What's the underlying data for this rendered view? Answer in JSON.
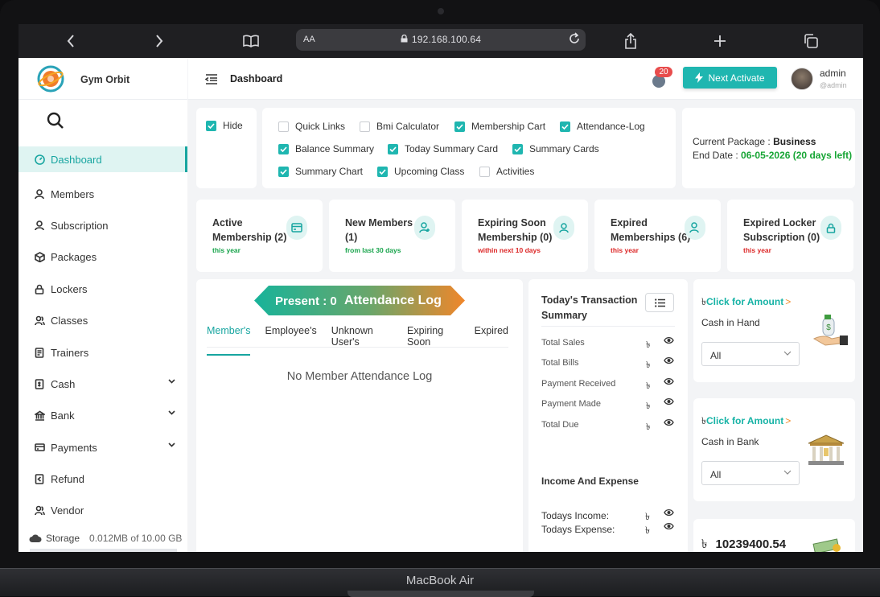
{
  "browser": {
    "address_prefix": "AA",
    "url": "192.168.100.64"
  },
  "device": {
    "label": "MacBook Air"
  },
  "app": {
    "name": "Gym Orbit"
  },
  "topbar": {
    "page_title": "Dashboard",
    "notification_count": "20",
    "next_activate_label": "Next Activate",
    "user_name": "admin",
    "user_handle": "@admin"
  },
  "sidebar": {
    "items": [
      {
        "label": "Dashboard",
        "icon": "dashboard-icon",
        "active": true
      },
      {
        "label": "Members",
        "icon": "user-icon"
      },
      {
        "label": "Subscription",
        "icon": "user-icon"
      },
      {
        "label": "Packages",
        "icon": "box-icon"
      },
      {
        "label": "Lockers",
        "icon": "lock-icon"
      },
      {
        "label": "Classes",
        "icon": "users-icon"
      },
      {
        "label": "Trainers",
        "icon": "document-icon"
      },
      {
        "label": "Cash",
        "icon": "cash-icon",
        "dropdown": true
      },
      {
        "label": "Bank",
        "icon": "bank-icon",
        "dropdown": true
      },
      {
        "label": "Payments",
        "icon": "payment-icon",
        "dropdown": true
      },
      {
        "label": "Refund",
        "icon": "refund-icon"
      },
      {
        "label": "Vendor",
        "icon": "users-icon"
      }
    ],
    "storage_label": "Storage",
    "storage_value": "0.012MB of 10.00 GB"
  },
  "settings": {
    "hide_label": "Hide",
    "options": [
      {
        "label": "Quick Links",
        "checked": false
      },
      {
        "label": "Bmi Calculator",
        "checked": false
      },
      {
        "label": "Membership Cart",
        "checked": true
      },
      {
        "label": "Attendance-Log",
        "checked": true
      },
      {
        "label": "Balance Summary",
        "checked": true
      },
      {
        "label": "Today Summary Card",
        "checked": true
      },
      {
        "label": "Summary Cards",
        "checked": true
      },
      {
        "label": "Summary Chart",
        "checked": true
      },
      {
        "label": "Upcoming Class",
        "checked": true
      },
      {
        "label": "Activities",
        "checked": false
      }
    ]
  },
  "package": {
    "current_label": "Current Package : ",
    "current_value": "Business",
    "end_label": "End Date : ",
    "end_value": "06-05-2026 (20 days left)"
  },
  "stats": [
    {
      "title_line1": "Active",
      "title_line2": "Membership (2)",
      "sub": "this year",
      "sub_color": "#16a34a",
      "icon": "card-icon"
    },
    {
      "title_line1": "New Members",
      "title_line2": "(1)",
      "sub": "from last 30 days",
      "sub_color": "#16a34a",
      "icon": "user-add-icon"
    },
    {
      "title_line1": "Expiring Soon",
      "title_line2": "Membership (0)",
      "sub": "within next 10 days",
      "sub_color": "#dc2626",
      "icon": "user-icon"
    },
    {
      "title_line1": "Expired",
      "title_line2": "Memberships (6)",
      "sub": "this year",
      "sub_color": "#dc2626",
      "icon": "user-check-icon"
    },
    {
      "title_line1": "Expired Locker",
      "title_line2": "Subscription (0)",
      "sub": "this year",
      "sub_color": "#dc2626",
      "icon": "lock-icon"
    }
  ],
  "attendance": {
    "present_text": "Present : 0",
    "title": "Attendance Log",
    "tabs": [
      "Member's",
      "Employee's",
      "Unknown User's",
      "Expiring Soon",
      "Expired"
    ],
    "empty_message": "No Member Attendance Log"
  },
  "transactions": {
    "title": "Today's Transaction Summary",
    "currency": "৳",
    "rows": [
      "Total Sales",
      "Total Bills",
      "Payment Received",
      "Payment Made",
      "Total Due"
    ],
    "income_title": "Income And Expense",
    "income_rows": [
      "Todays Income:",
      "Todays Expense:"
    ]
  },
  "cash_hand": {
    "currency": "৳",
    "click_label": "Click for Amount",
    "arrow": ">",
    "label": "Cash in Hand",
    "select_value": "All"
  },
  "cash_bank": {
    "currency": "৳",
    "click_label": "Click for Amount",
    "arrow": ">",
    "label": "Cash in Bank",
    "select_value": "All"
  },
  "total_amount": {
    "currency": "৳",
    "value": "10239400.54"
  }
}
